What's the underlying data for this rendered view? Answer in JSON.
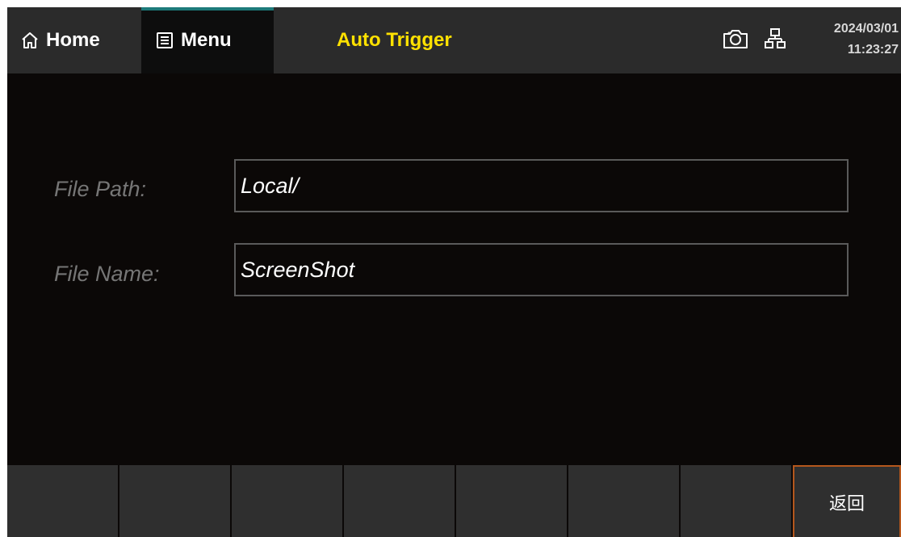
{
  "header": {
    "home_label": "Home",
    "menu_label": "Menu",
    "title": "Auto Trigger",
    "date": "2024/03/01",
    "time": "11:23:27"
  },
  "form": {
    "file_path": {
      "label": "File Path:",
      "value": "Local/"
    },
    "file_name": {
      "label": "File Name:",
      "value": "ScreenShot"
    }
  },
  "softkeys": [
    "",
    "",
    "",
    "",
    "",
    "",
    "",
    "返回"
  ],
  "icons": {
    "home": "home-icon",
    "menu": "menu-list-icon",
    "camera": "camera-icon",
    "network": "network-icon"
  },
  "colors": {
    "title": "#ffe100",
    "background": "#0b0807",
    "topbar": "#2b2b2b",
    "softkey": "#2f2f2f",
    "active_softkey_border": "#b5571c",
    "menu_accent": "#1d7a7a"
  }
}
